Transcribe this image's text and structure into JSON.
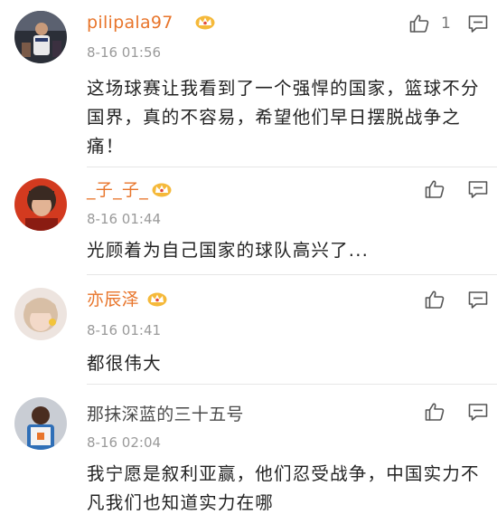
{
  "comments": [
    {
      "username": "pilipala97",
      "vip": true,
      "time": "8-16 01:56",
      "text": "这场球赛让我看到了一个强悍的国家，篮球不分国界，真的不容易，希望他们早日摆脱战争之痛！",
      "likes": "1",
      "icons": {
        "like": "thumbs-up-icon",
        "reply": "comment-icon",
        "badge": "vip-crown-icon"
      }
    },
    {
      "username": "_子_子_",
      "vip": true,
      "time": "8-16 01:44",
      "text": "光顾着为自己国家的球队高兴了...",
      "likes": "",
      "icons": {
        "like": "thumbs-up-icon",
        "reply": "comment-icon",
        "badge": "vip-crown-icon"
      }
    },
    {
      "username": "亦辰泽",
      "vip": true,
      "time": "8-16 01:41",
      "text": "都很伟大",
      "likes": "",
      "icons": {
        "like": "thumbs-up-icon",
        "reply": "comment-icon",
        "badge": "vip-crown-icon"
      }
    },
    {
      "username": "那抹深蓝的三十五号",
      "vip": false,
      "time": "8-16 02:04",
      "text": "我宁愿是叙利亚赢，他们忍受战争，中国实力不凡我们也知道实力在哪",
      "likes": "",
      "icons": {
        "like": "thumbs-up-icon",
        "reply": "comment-icon"
      }
    }
  ],
  "colors": {
    "vip_name": "#e8752b",
    "plain_name": "#4a4a4a",
    "text": "#222222",
    "time": "#9a9a9a",
    "crown": "#f0a31c",
    "separator": "#e6e6e6"
  }
}
